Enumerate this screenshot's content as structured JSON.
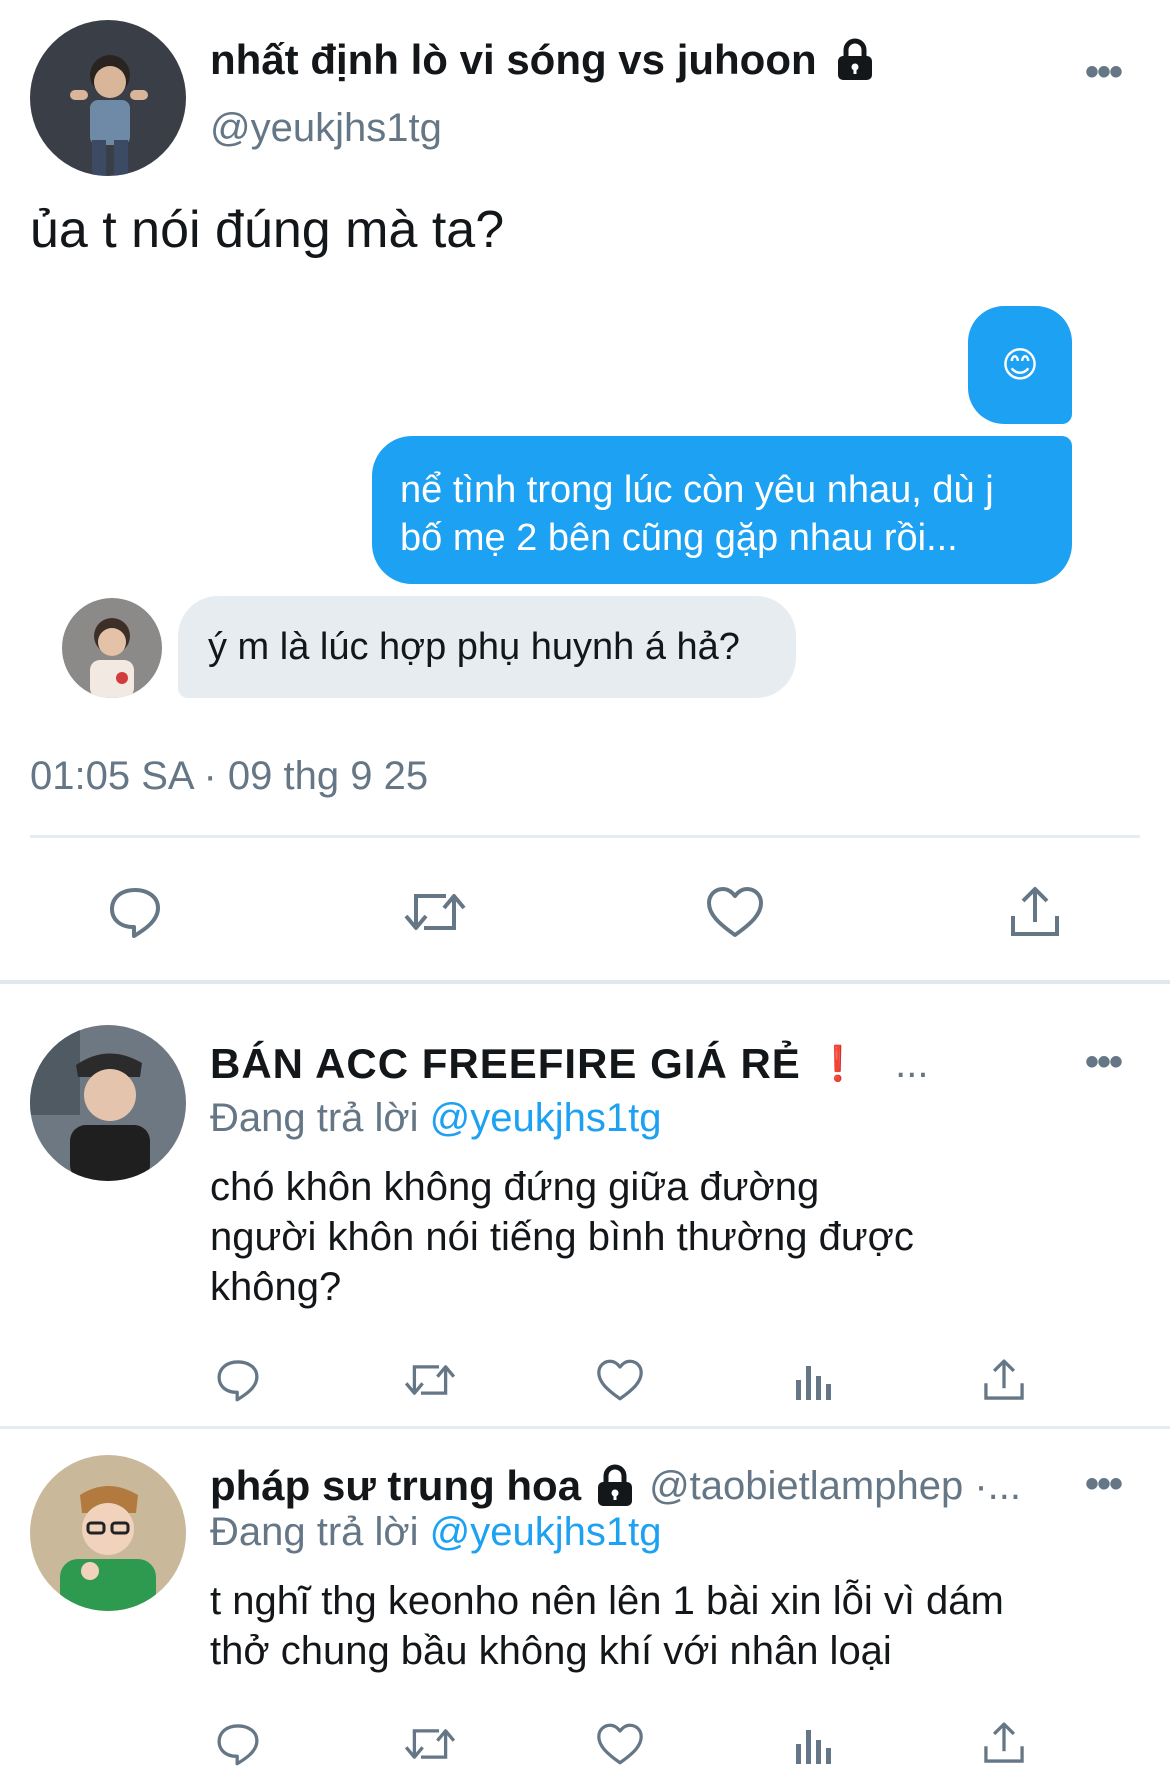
{
  "main_tweet": {
    "display_name": "nhất định lò vi sóng vs juhoon",
    "handle": "@yeukjhs1tg",
    "text": "ủa t nói đúng mà ta?",
    "timestamp": "01:05 SA · 09 thg 9 25",
    "dm_bubbles": {
      "emoji": "😊",
      "outgoing": "nể tình trong lúc còn yêu nhau, dù j bố mẹ 2 bên cũng gặp nhau rồi...",
      "incoming": "ý m là lúc hợp phụ huynh á hả?"
    }
  },
  "replies": [
    {
      "display_name": "BÁN ACC FREEFIRE GIÁ RẺ",
      "badge": "❗",
      "handle_truncated": "...",
      "replying_prefix": "Đang trả lời",
      "replying_to": "@yeukjhs1tg",
      "text": "chó khôn không đứng giữa đường\nngười khôn nói tiếng bình thường được\nkhông?"
    },
    {
      "display_name": "pháp sư trung hoa",
      "handle_truncated": "@taobietlamphep ·...",
      "replying_prefix": "Đang trả lời",
      "replying_to": "@yeukjhs1tg",
      "text": "t nghĩ thg keonho nên lên 1 bài xin lỗi vì dám\nthở chung bầu không khí với nhân loại"
    }
  ],
  "more_label": "•••",
  "colors": {
    "accent": "#1da1f2",
    "secondary_text": "#657786",
    "bubble_in": "#e6ecf0"
  },
  "icons": [
    "reply-icon",
    "retweet-icon",
    "like-icon",
    "share-icon",
    "analytics-icon",
    "lock-icon",
    "more-icon"
  ]
}
